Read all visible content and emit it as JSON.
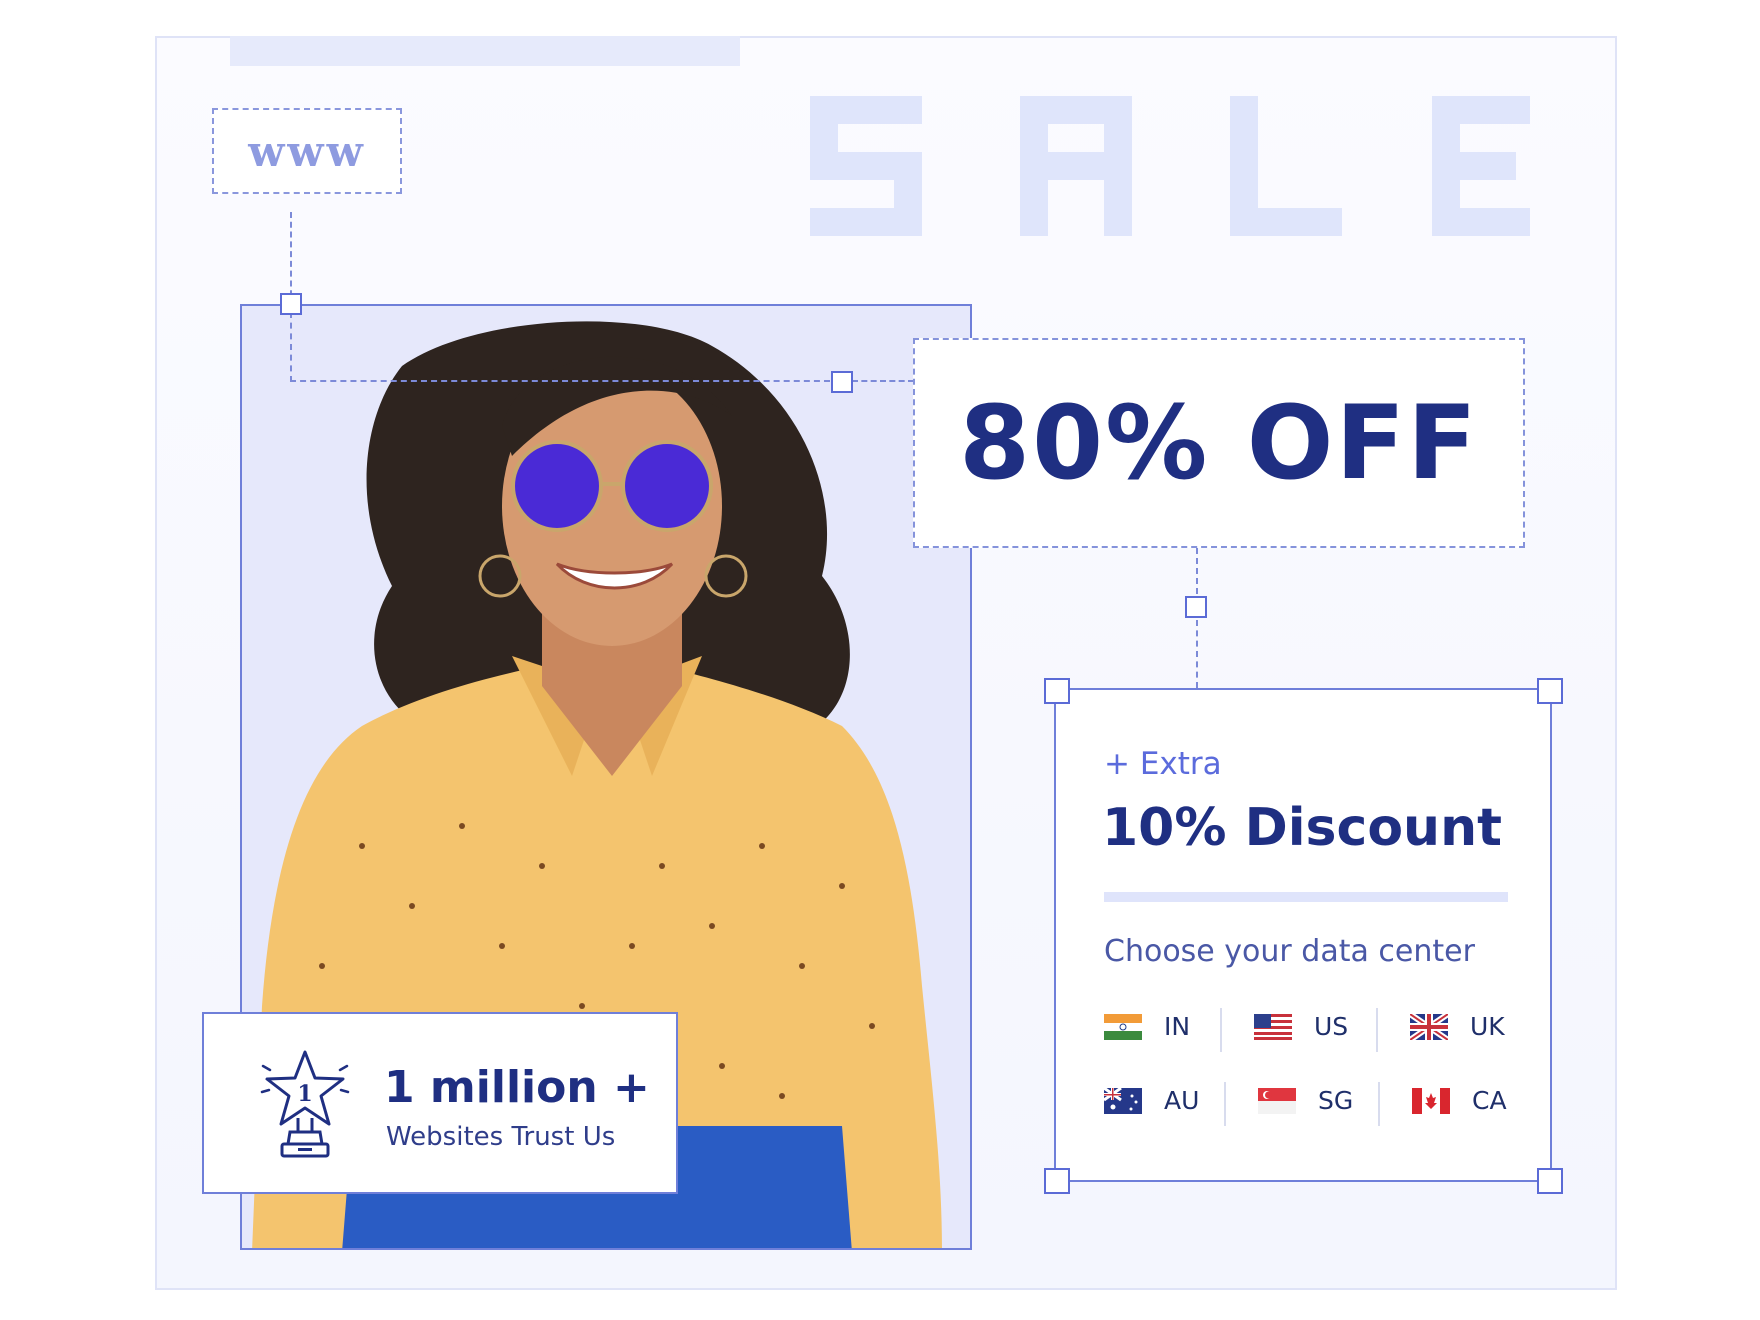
{
  "banner": {
    "www_label": "www",
    "sale_word": "SALE",
    "offer": "80% OFF",
    "colors": {
      "primary_navy": "#1f2f82",
      "accent_blue": "#5b6bdc",
      "frame_line": "#6f7fd9",
      "pale_tint": "#dfe5fb"
    }
  },
  "discount_card": {
    "extra_label": "+ Extra",
    "title": "10% Discount",
    "data_center_label": "Choose your data center",
    "countries": [
      {
        "code": "IN",
        "flag": "india-flag-icon"
      },
      {
        "code": "US",
        "flag": "usa-flag-icon"
      },
      {
        "code": "UK",
        "flag": "uk-flag-icon"
      },
      {
        "code": "AU",
        "flag": "australia-flag-icon"
      },
      {
        "code": "SG",
        "flag": "singapore-flag-icon"
      },
      {
        "code": "CA",
        "flag": "canada-flag-icon"
      }
    ]
  },
  "trust": {
    "count": "1 million +",
    "label": "Websites Trust Us",
    "badge_number": "1",
    "icon": "award-trophy-star-icon"
  },
  "photo": {
    "icon": "model-photo-illustration"
  }
}
